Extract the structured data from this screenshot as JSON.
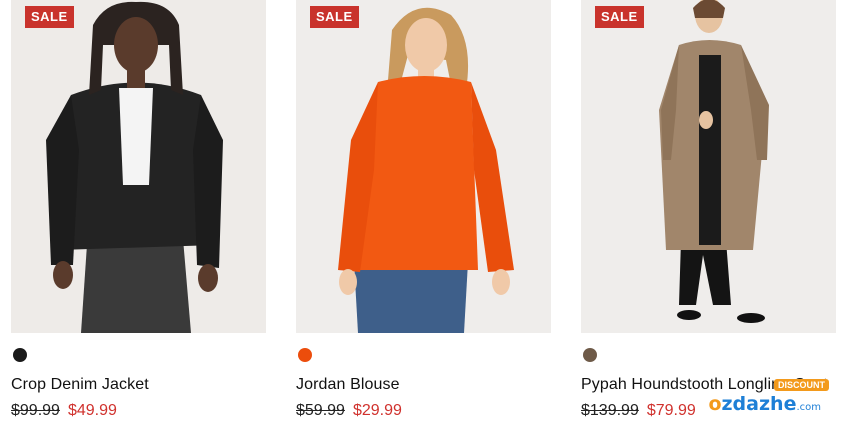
{
  "products": [
    {
      "badge": "SALE",
      "name": "Crop Denim Jacket",
      "was_price": "$99.99",
      "price": "$49.99",
      "swatch_color": "#1a1a1a",
      "image_alt": "Crop Denim Jacket"
    },
    {
      "badge": "SALE",
      "name": "Jordan Blouse",
      "was_price": "$59.99",
      "price": "$29.99",
      "swatch_color": "#ec4d0c",
      "image_alt": "Jordan Blouse"
    },
    {
      "badge": "SALE",
      "name": "Pypah Houndstooth Longline Coat",
      "was_price": "$139.99",
      "price": "$79.99",
      "swatch_color": "#6e5a48",
      "image_alt": "Pypah Houndstooth Longline Coat"
    }
  ],
  "watermark": {
    "brand_o": "o",
    "brand_rest": "zdazhe",
    "suffix": ".com",
    "tag": "DISCOUNT"
  }
}
